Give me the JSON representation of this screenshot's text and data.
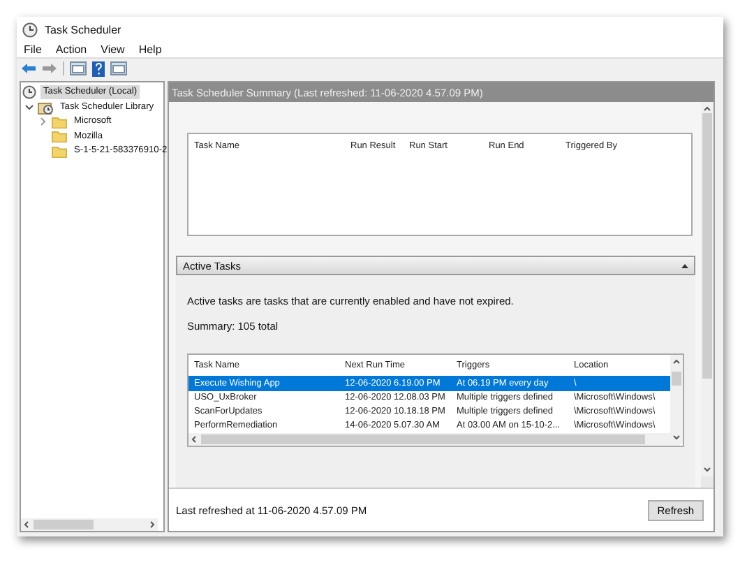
{
  "window": {
    "title": "Task Scheduler"
  },
  "menu": [
    {
      "label": "File"
    },
    {
      "label": "Action"
    },
    {
      "label": "View"
    },
    {
      "label": "Help"
    }
  ],
  "tree": [
    {
      "label": "Task Scheduler (Local)",
      "kind": "clock",
      "selected": true,
      "children": [
        {
          "label": "Task Scheduler Library",
          "kind": "library",
          "selected": false,
          "expanded": true,
          "children": [
            {
              "label": "Microsoft",
              "kind": "folder",
              "selected": false,
              "expanded": false
            },
            {
              "label": "Mozilla",
              "kind": "folder",
              "selected": false
            },
            {
              "label": "S-1-5-21-583376910-2",
              "kind": "folder",
              "selected": false
            }
          ]
        }
      ]
    }
  ],
  "summary_header": "Task Scheduler Summary (Last refreshed: 11-06-2020 4.57.09 PM)",
  "status_table": {
    "columns": [
      "Task Name",
      "Run Result",
      "Run Start",
      "Run End",
      "Triggered By"
    ]
  },
  "active_tasks": {
    "title": "Active Tasks",
    "expanded": true,
    "description": "Active tasks are tasks that are currently enabled and have not expired.",
    "summary": "Summary: 105 total",
    "table": {
      "columns": [
        "Task Name",
        "Next Run Time",
        "Triggers",
        "Location"
      ],
      "rows": [
        {
          "cells": [
            "Execute Wishing App",
            "12-06-2020 6.19.00 PM",
            "At 06.19 PM every day",
            "\\"
          ],
          "selected": true
        },
        {
          "cells": [
            "USO_UxBroker",
            "12-06-2020 12.08.03 PM",
            "Multiple triggers defined",
            "\\Microsoft\\Windows\\"
          ],
          "selected": false
        },
        {
          "cells": [
            "ScanForUpdates",
            "12-06-2020 10.18.18 PM",
            "Multiple triggers defined",
            "\\Microsoft\\Windows\\"
          ],
          "selected": false
        },
        {
          "cells": [
            "PerformRemediation",
            "14-06-2020 5.07.30 AM",
            "At 03.00 AM on 15-10-2...",
            "\\Microsoft\\Windows\\"
          ],
          "selected": false
        }
      ]
    }
  },
  "footer": {
    "text": "Last refreshed at 11-06-2020 4.57.09 PM",
    "button": "Refresh"
  }
}
